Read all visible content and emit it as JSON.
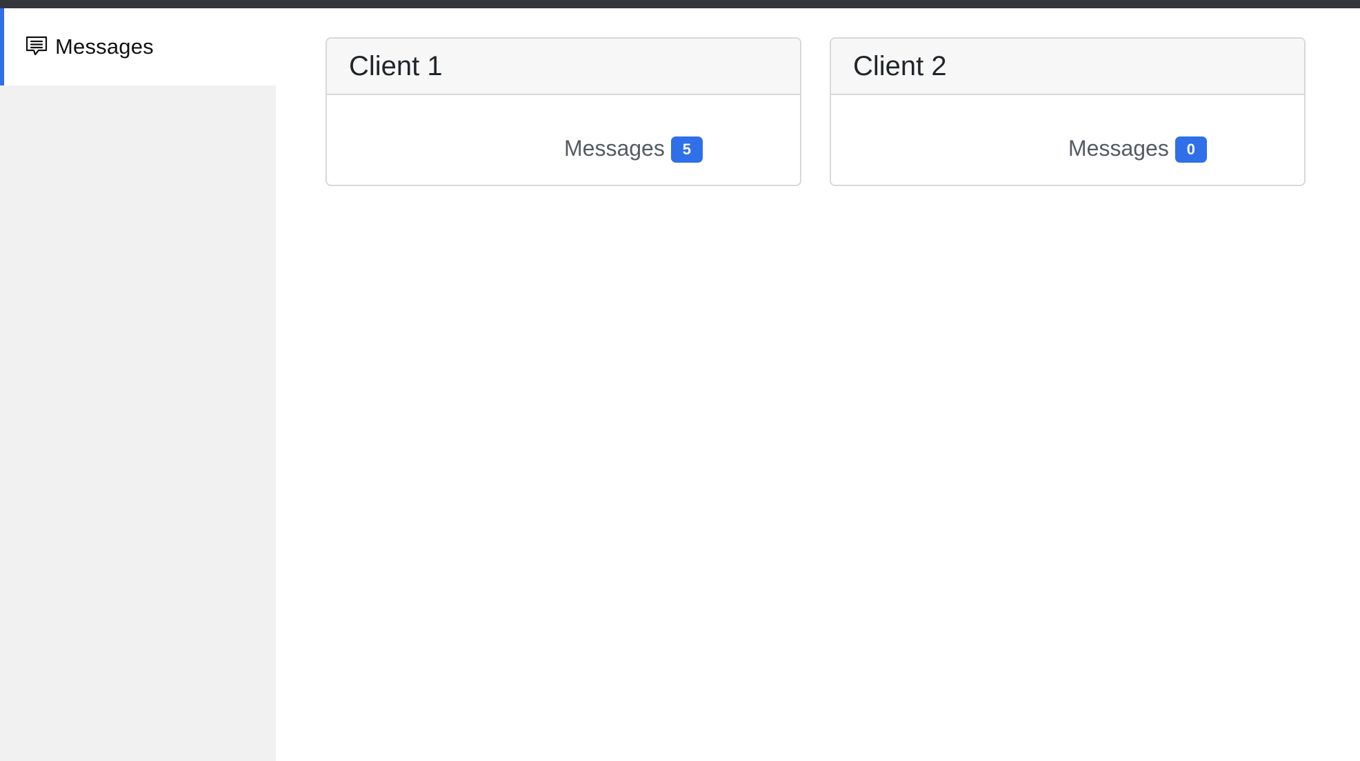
{
  "sidebar": {
    "items": [
      {
        "label": "Messages",
        "icon": "chat-message-icon",
        "active": true
      }
    ]
  },
  "clients": [
    {
      "title": "Client 1",
      "messages_label": "Messages",
      "messages_count": "5"
    },
    {
      "title": "Client 2",
      "messages_label": "Messages",
      "messages_count": "0"
    }
  ],
  "colors": {
    "topbar": "#33363b",
    "sidebar_bg": "#f1f1f1",
    "accent": "#2f6fe8",
    "card_header_bg": "#f7f7f7",
    "card_border": "#d8d8d8"
  }
}
